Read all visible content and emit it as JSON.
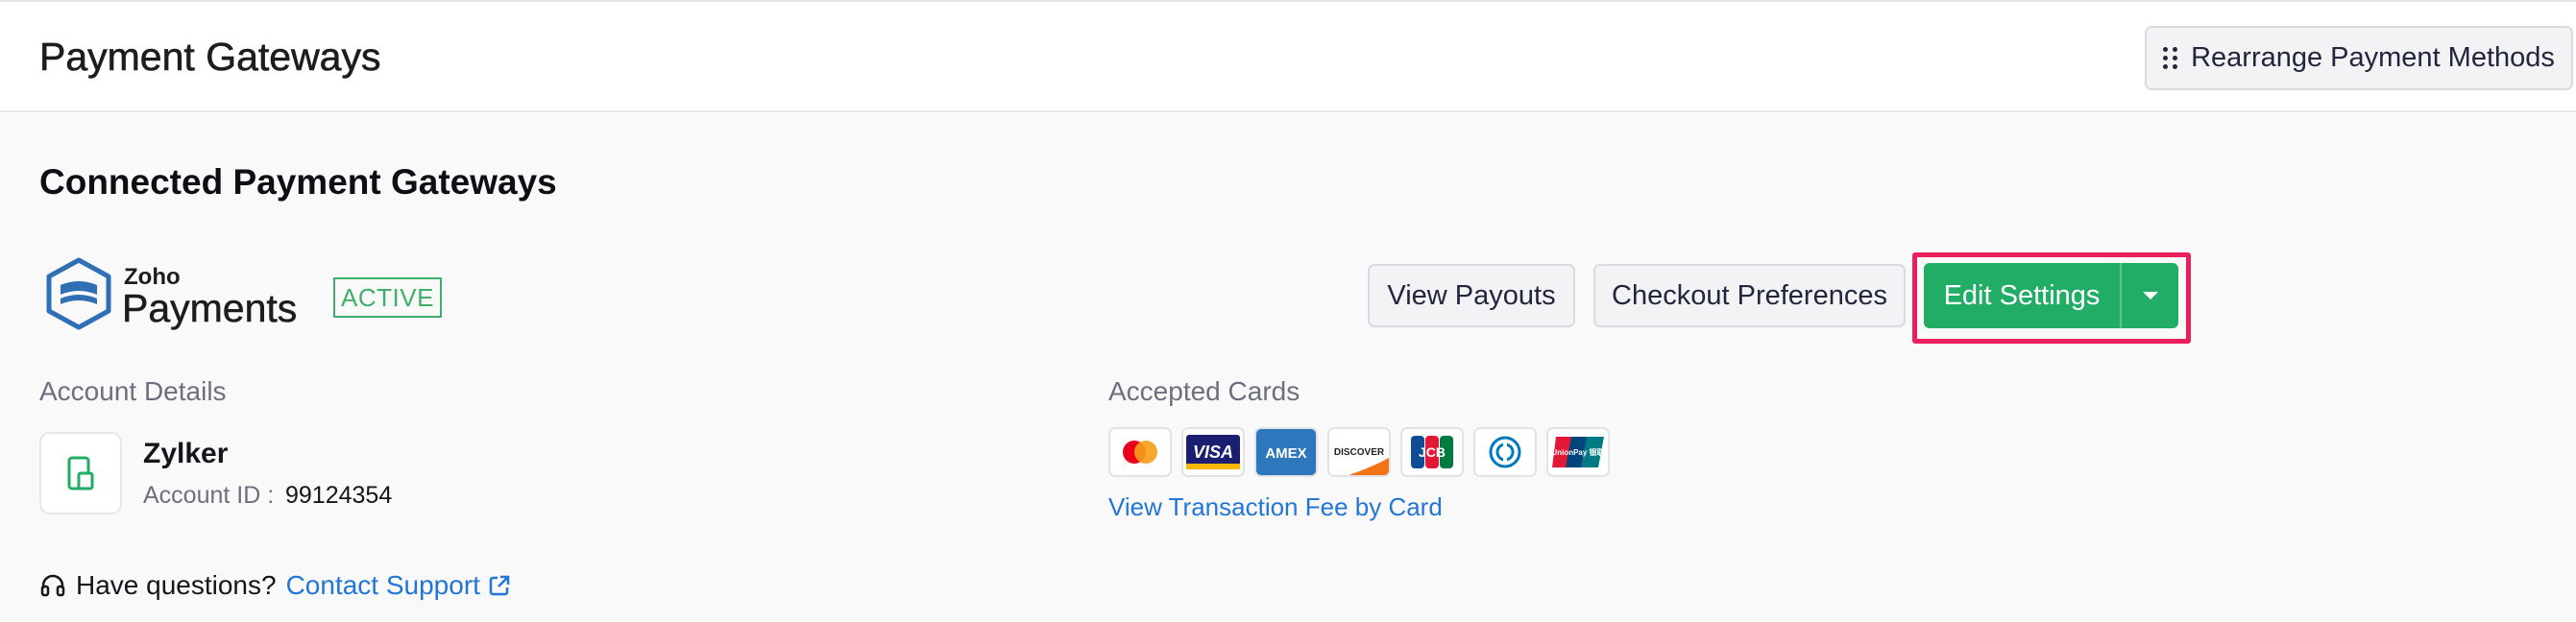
{
  "header": {
    "title": "Payment Gateways",
    "rearrange_label": "Rearrange Payment Methods"
  },
  "section": {
    "title": "Connected Payment Gateways"
  },
  "gateway": {
    "logo_line1": "Zoho",
    "logo_line2": "Payments",
    "status": "ACTIVE",
    "brand_color": "#2f6fb5"
  },
  "actions": {
    "view_payouts": "View Payouts",
    "checkout_preferences": "Checkout Preferences",
    "edit_settings": "Edit Settings",
    "primary_color": "#22ad66",
    "highlight_color": "#ea1f5c"
  },
  "account": {
    "label": "Account Details",
    "name": "Zylker",
    "id_label": "Account ID :",
    "id_value": "99124354"
  },
  "cards": {
    "label": "Accepted Cards",
    "items": [
      {
        "name": "mastercard-icon",
        "text": ""
      },
      {
        "name": "visa-icon",
        "text": "VISA"
      },
      {
        "name": "amex-icon",
        "text": "AMEX"
      },
      {
        "name": "discover-icon",
        "text": "DISCOVER"
      },
      {
        "name": "jcb-icon",
        "text": "JCB"
      },
      {
        "name": "diners-icon",
        "text": ""
      },
      {
        "name": "unionpay-icon",
        "text": "UnionPay 银联"
      }
    ],
    "fee_link": "View Transaction Fee by Card"
  },
  "help": {
    "question": "Have questions?",
    "link": "Contact Support"
  }
}
